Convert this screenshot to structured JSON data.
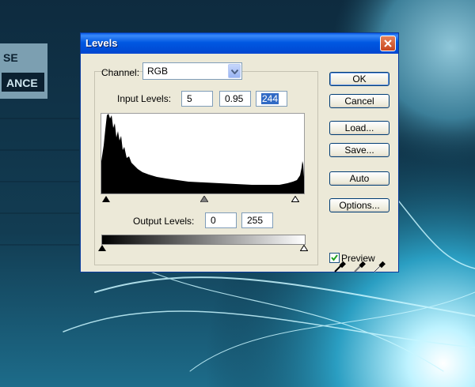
{
  "dialog": {
    "title": "Levels",
    "channel_label": "Channel:",
    "channel_value": "RGB",
    "input_levels_label": "Input Levels:",
    "input_levels": [
      "5",
      "0.95",
      "244"
    ],
    "output_levels_label": "Output Levels:",
    "output_levels": [
      "0",
      "255"
    ],
    "buttons": {
      "ok": "OK",
      "cancel": "Cancel",
      "load": "Load...",
      "save": "Save...",
      "auto": "Auto",
      "options": "Options..."
    },
    "preview_label": "Preview",
    "preview_checked": true,
    "colors": {
      "titlebar": "#0058e2",
      "dialog_bg": "#ece9d8",
      "close": "#d2542c"
    }
  },
  "background": {
    "poster_text": [
      "SE",
      "ANCE"
    ]
  },
  "icons": [
    "close-icon",
    "dropdown-arrow-icon",
    "black-point-eyedropper-icon",
    "gray-point-eyedropper-icon",
    "white-point-eyedropper-icon",
    "checkmark-icon"
  ]
}
